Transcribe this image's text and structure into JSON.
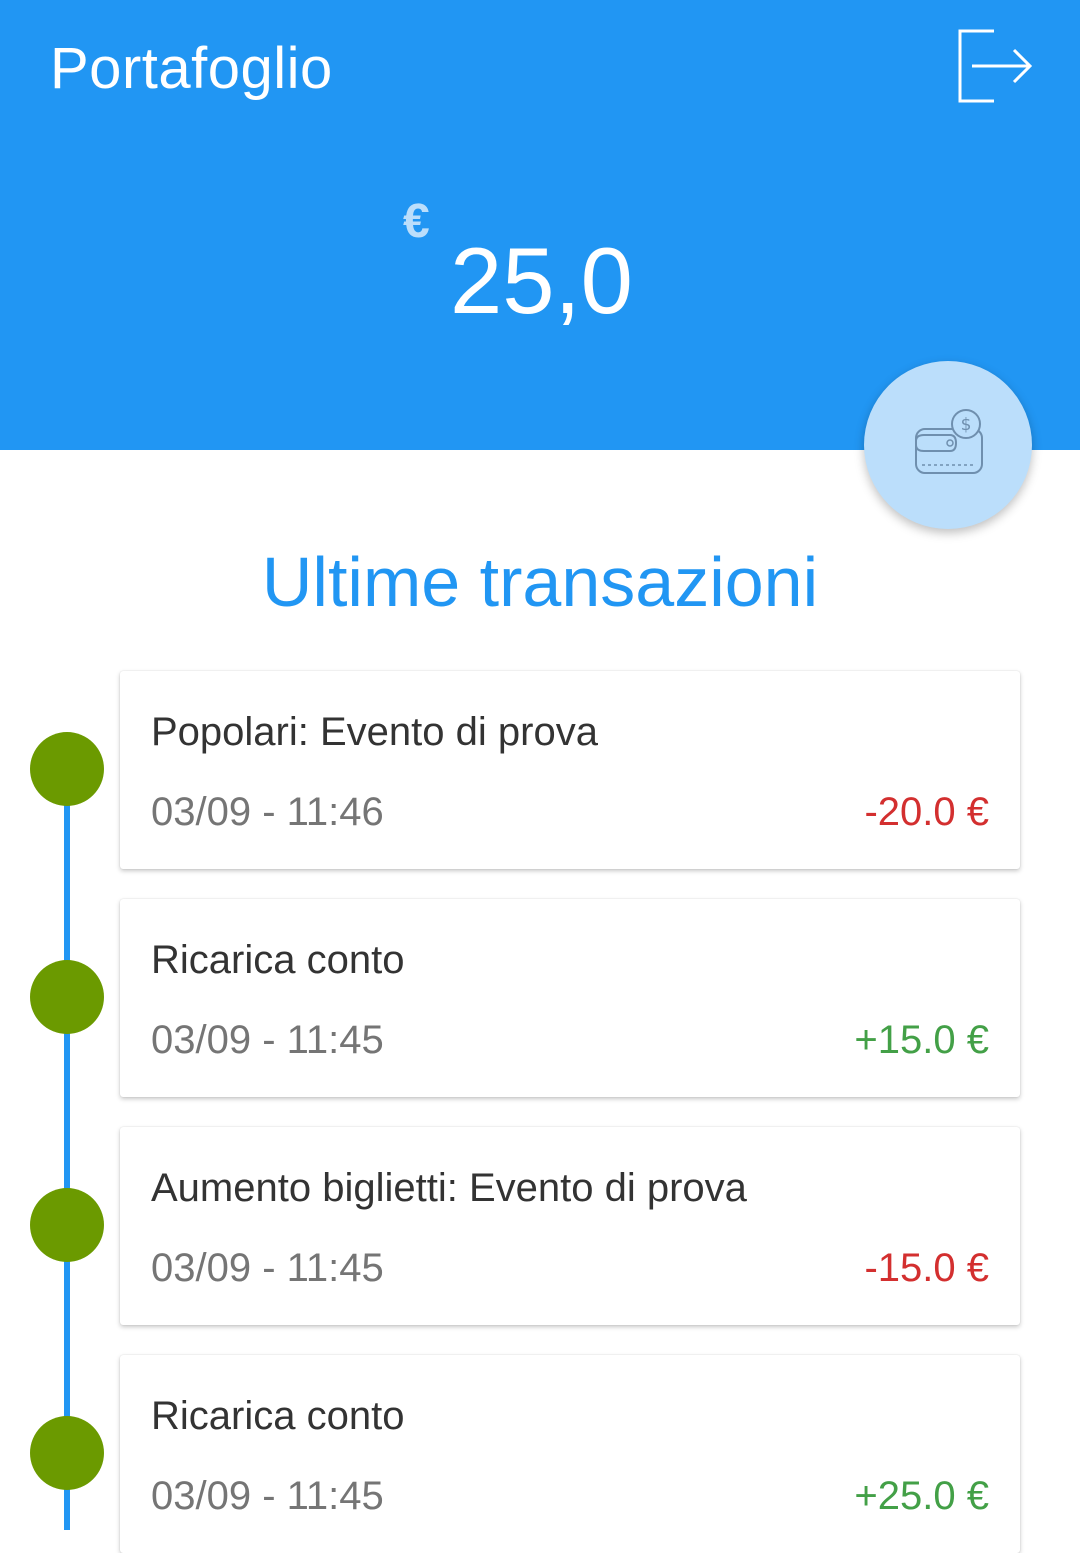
{
  "header": {
    "title": "Portafoglio",
    "logout_icon": "logout-icon",
    "background_color": "#2196F3"
  },
  "balance": {
    "currency": "€",
    "amount": "25,0"
  },
  "wallet_button": {
    "icon": "wallet-icon"
  },
  "section": {
    "title": "Ultime transazioni"
  },
  "transactions": [
    {
      "description": "Popolari: Evento di prova",
      "datetime": "03/09 - 11:46",
      "amount": "-20.0 €",
      "type": "debit"
    },
    {
      "description": "Ricarica conto",
      "datetime": "03/09 - 11:45",
      "amount": "+15.0 €",
      "type": "credit"
    },
    {
      "description": "Aumento biglietti: Evento di prova",
      "datetime": "03/09 - 11:45",
      "amount": "-15.0 €",
      "type": "debit"
    },
    {
      "description": "Ricarica conto",
      "datetime": "03/09 - 11:45",
      "amount": "+25.0 €",
      "type": "credit"
    }
  ],
  "colors": {
    "primary": "#2196F3",
    "debit": "#D32F2F",
    "credit": "#43A047",
    "timeline_dot": "#6B9A00"
  }
}
